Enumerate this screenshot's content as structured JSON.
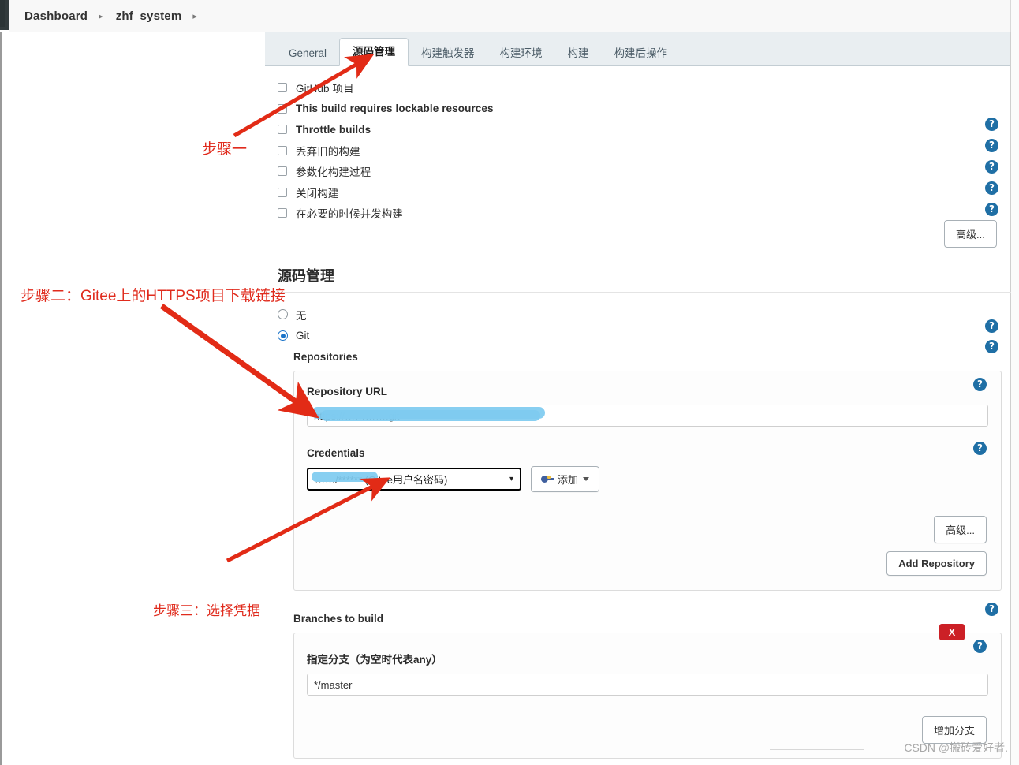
{
  "breadcrumb": {
    "items": [
      {
        "label": "Dashboard"
      },
      {
        "label": "zhf_system"
      }
    ],
    "separator": "▸",
    "trailing_separator": "▸"
  },
  "tabs": [
    {
      "label": "General",
      "active": false
    },
    {
      "label": "源码管理",
      "active": true
    },
    {
      "label": "构建触发器",
      "active": false
    },
    {
      "label": "构建环境",
      "active": false
    },
    {
      "label": "构建",
      "active": false
    },
    {
      "label": "构建后操作",
      "active": false
    }
  ],
  "general_checkboxes": [
    {
      "label": "GitHub 项目",
      "checked": false,
      "cjk": true
    },
    {
      "label": "This build requires lockable resources",
      "checked": false,
      "cjk": false
    },
    {
      "label": "Throttle builds",
      "checked": false,
      "cjk": false
    },
    {
      "label": "丢弃旧的构建",
      "checked": false,
      "cjk": true
    },
    {
      "label": "参数化构建过程",
      "checked": false,
      "cjk": true
    },
    {
      "label": "关闭构建",
      "checked": false,
      "cjk": true
    },
    {
      "label": "在必要的时候并发构建",
      "checked": false,
      "cjk": true
    }
  ],
  "help_icon": {
    "glyph": "?",
    "name": "help-icon",
    "color": "#1f6fa5"
  },
  "buttons": {
    "advanced_top": "高级...",
    "advanced_repo": "高级...",
    "add_repository": "Add Repository",
    "add_credential": "添加",
    "add_branch": "增加分支",
    "delete_badge": "X"
  },
  "scm": {
    "section_title": "源码管理",
    "options": [
      {
        "label": "无",
        "selected": false
      },
      {
        "label": "Git",
        "selected": true
      }
    ],
    "repositories_label": "Repositories",
    "repository_url_label": "Repository URL",
    "repository_url_value": "https://………….git",
    "credentials_label": "Credentials",
    "credentials_value": "……/****** (Gitee用户名密码)",
    "credentials_value_suffix": "/****** (Gitee用户名密码)",
    "branches_label": "Branches to build",
    "branch_specifier_label": "指定分支（为空时代表any）",
    "branch_specifier_value": "*/master"
  },
  "annotations": [
    {
      "id": "step1",
      "text": "步骤一"
    },
    {
      "id": "step2",
      "text": "步骤二：Gitee上的HTTPS项目下载链接"
    },
    {
      "id": "step3",
      "text": "步骤三：选择凭据"
    }
  ],
  "watermark": {
    "text": "CSDN @搬砖爱好者."
  },
  "colors": {
    "accent_blue": "#1f6fa5",
    "annotation_red": "#e02b1d",
    "redaction_blue": "#7ecbf0",
    "delete_red": "#cc2026",
    "tabbar_bg": "#e9eef1"
  }
}
